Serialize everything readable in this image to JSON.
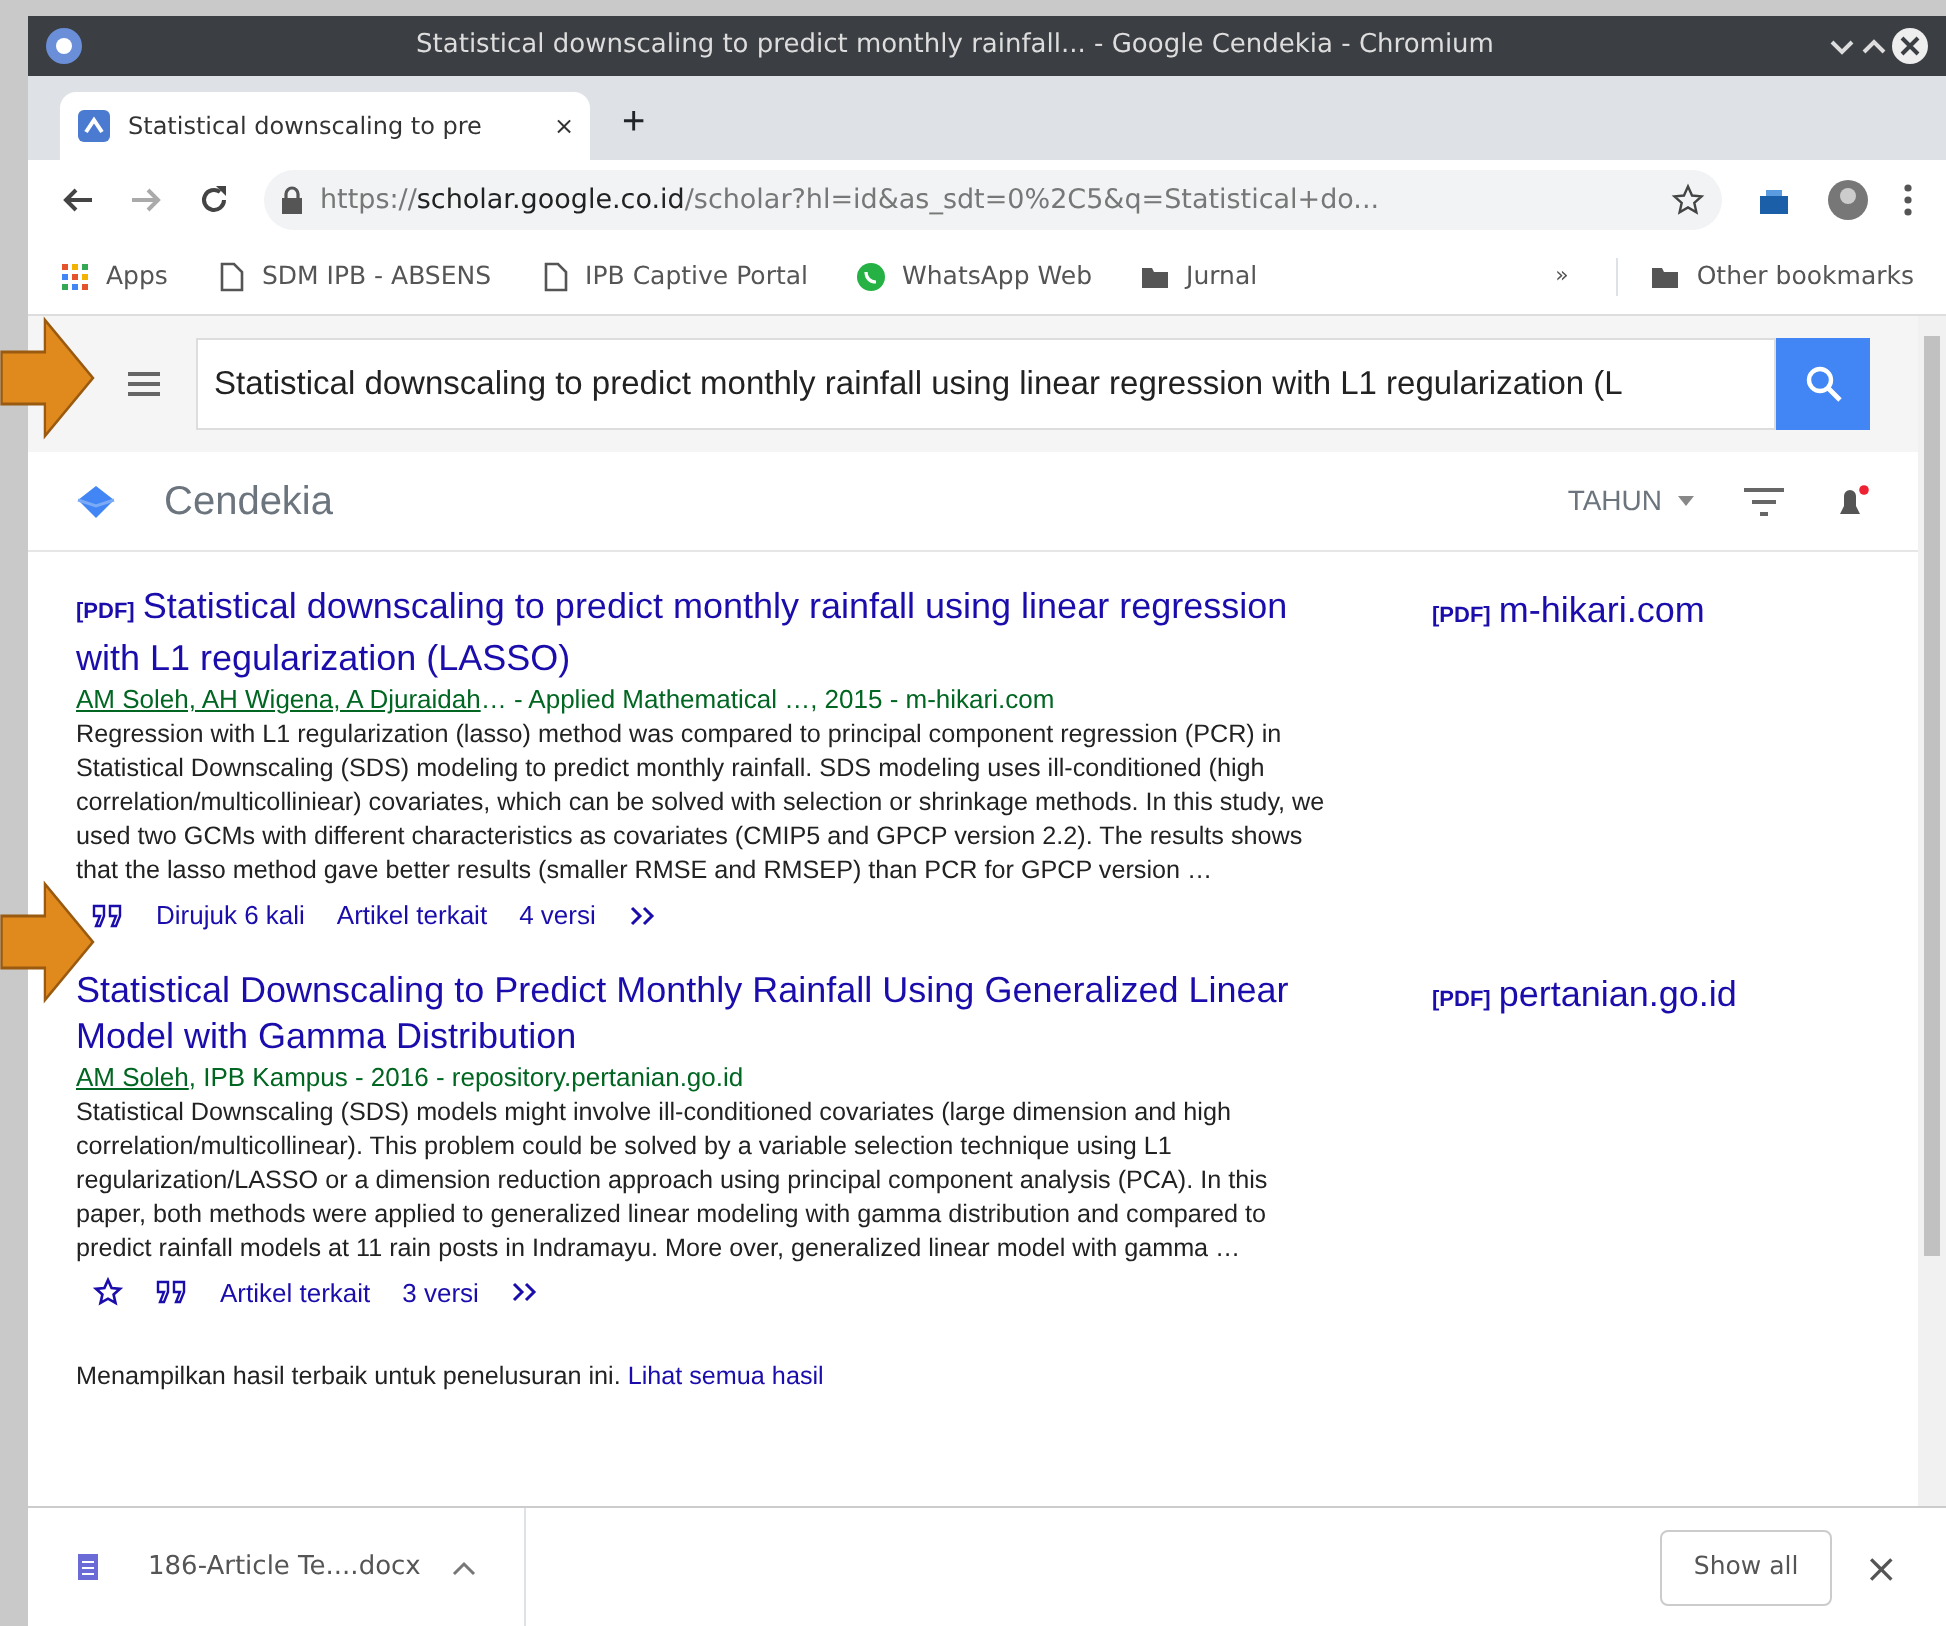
{
  "window": {
    "title": "Statistical downscaling to predict monthly rainfall... - Google Cendekia - Chromium"
  },
  "tabs": [
    {
      "title": "Statistical downscaling to pre",
      "close": "×",
      "selected": true
    }
  ],
  "new_tab": "+",
  "address": {
    "scheme": "https://",
    "host": "scholar.google.co.id",
    "path": "/scholar?hl=id&as_sdt=0%2C5&q=Statistical+do..."
  },
  "bookmarks": [
    {
      "kind": "apps",
      "label": "Apps"
    },
    {
      "kind": "page",
      "label": "SDM IPB - ABSENS"
    },
    {
      "kind": "page",
      "label": "IPB Captive Portal"
    },
    {
      "kind": "chat",
      "label": "WhatsApp Web"
    },
    {
      "kind": "folder",
      "label": "Jurnal"
    }
  ],
  "bookmarks_overflow": "»",
  "other_bookmarks": "Other bookmarks",
  "scholar": {
    "search": {
      "value": "Statistical downscaling to predict monthly rainfall using linear regression with L1 regularization (L"
    },
    "brand": "Cendekia",
    "year_filter": "TAHUN"
  },
  "results": [
    {
      "tag": "[PDF]",
      "title": "Statistical downscaling to predict monthly rainfall using linear regression with L1 regularization (LASSO)",
      "meta": {
        "authors": "AM Soleh, AH Wigena, A Djuraidah",
        "source": "… - Applied Mathematical …, 2015 - m-hikari.com"
      },
      "snippet": "Regression with L1 regularization (lasso) method was compared to principal component regression (PCR) in Statistical Downscaling (SDS) modeling to predict monthly rainfall. SDS modeling uses ill-conditioned (high correlation/multicolliniear) covariates, which can be solved with selection or shrinkage methods. In this study, we used two GCMs with different characteristics as covariates (CMIP5 and GPCP version 2.2). The results shows that the lasso method gave better results (smaller RMSE and RMSEP) than PCR for GPCP version …",
      "actions": [
        {
          "kind": "cite"
        },
        {
          "kind": "link",
          "label": "Dirujuk 6 kali"
        },
        {
          "kind": "link",
          "label": "Artikel terkait"
        },
        {
          "kind": "link",
          "label": "4 versi"
        },
        {
          "kind": "more"
        }
      ],
      "side": {
        "tag": "[PDF]",
        "domain": "m-hikari.com"
      }
    },
    {
      "title": "Statistical Downscaling to Predict Monthly Rainfall Using Generalized Linear Model with Gamma Distribution",
      "meta": {
        "authors": "AM Soleh",
        "source": ", IPB Kampus - 2016 - repository.pertanian.go.id"
      },
      "snippet": "Statistical Downscaling (SDS) models might involve ill-conditioned covariates (large dimension and high correlation/multicollinear). This problem could be solved by a variable selection technique using L1 regularization/LASSO or a dimension reduction approach using principal component analysis (PCA). In this paper, both methods were applied to generalized linear modeling with gamma distribution and compared to predict rainfall models at 11 rain posts in Indramayu. More over, generalized linear model with gamma …",
      "actions": [
        {
          "kind": "star"
        },
        {
          "kind": "cite"
        },
        {
          "kind": "link",
          "label": "Artikel terkait"
        },
        {
          "kind": "link",
          "label": "3 versi"
        },
        {
          "kind": "more"
        }
      ],
      "side": {
        "tag": "[PDF]",
        "domain": "pertanian.go.id"
      }
    }
  ],
  "footer": {
    "text": "Menampilkan hasil terbaik untuk penelusuran ini.",
    "link": "Lihat semua hasil"
  },
  "downloads": {
    "file": "186-Article Te....docx",
    "show_all": "Show all",
    "close": "×"
  }
}
